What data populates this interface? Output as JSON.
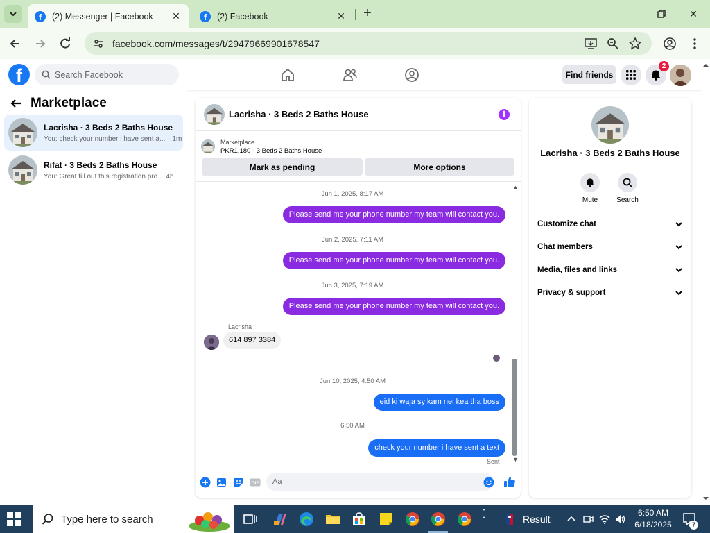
{
  "browser": {
    "tabs": [
      {
        "title": "(2) Messenger | Facebook",
        "active": true
      },
      {
        "title": "(2) Facebook",
        "active": false
      }
    ],
    "url": "facebook.com/messages/t/29479669901678547"
  },
  "fb": {
    "logo_letter": "f",
    "search_placeholder": "Search Facebook",
    "find_friends": "Find friends",
    "notif_count": "2"
  },
  "left": {
    "title": "Marketplace",
    "conversations": [
      {
        "name": "Lacrisha · 3 Beds 2 Baths House",
        "preview": "You: check your number i have sent a...",
        "time": "· 1m",
        "selected": true
      },
      {
        "name": "Rifat · 3 Beds 2 Baths House",
        "preview": "You: Great fill out this registration pro...",
        "time": "4h",
        "selected": false
      }
    ]
  },
  "chat": {
    "title": "Lacrisha · 3 Beds 2 Baths House",
    "info_glyph": "i",
    "marketplace": {
      "label": "Marketplace",
      "listing": "PKR1,180 - 3 Beds 2 Baths House"
    },
    "buttons": {
      "pending": "Mark as pending",
      "more": "More options"
    },
    "timeline": [
      {
        "type": "time",
        "text": "Jun 1, 2025, 8:17 AM"
      },
      {
        "type": "out",
        "text": "Please send me your phone number my team will contact you.",
        "color": "#8a2be2"
      },
      {
        "type": "time",
        "text": "Jun 2, 2025, 7:11 AM"
      },
      {
        "type": "out",
        "text": "Please send me your phone number my team will contact you.",
        "color": "#8a2be2"
      },
      {
        "type": "time",
        "text": "Jun 3, 2025, 7:19 AM"
      },
      {
        "type": "out",
        "text": "Please send me your phone number my team will contact you.",
        "color": "#8a2be2"
      },
      {
        "type": "sender",
        "text": "Lacrisha"
      },
      {
        "type": "in",
        "text": "614 897 3384"
      },
      {
        "type": "time",
        "text": "Jun 10, 2025, 4:50 AM"
      },
      {
        "type": "out",
        "text": "eid ki waja sy   kam nei kea tha boss",
        "color": "#1a6ef5"
      },
      {
        "type": "time",
        "text": "6:50 AM"
      },
      {
        "type": "out",
        "text": "check your number i have sent a text",
        "color": "#1a6ef5"
      }
    ],
    "sent_label": "Sent",
    "composer_placeholder": "Aa"
  },
  "info": {
    "name": "Lacrisha · 3 Beds 2 Baths House",
    "actions": [
      {
        "label": "Mute"
      },
      {
        "label": "Search"
      }
    ],
    "sections": [
      "Customize chat",
      "Chat members",
      "Media, files and links",
      "Privacy & support"
    ]
  },
  "taskbar": {
    "search_text": "Type here to search",
    "widget": "Result",
    "time": "6:50 AM",
    "date": "6/18/2025",
    "notif_count": "7"
  },
  "colors": {
    "fb_blue": "#1877f2",
    "purple_bubble": "#8a2be2",
    "blue_bubble": "#1a6ef5",
    "tab_strip": "#cfe9c6",
    "taskbar": "#203f5c"
  }
}
